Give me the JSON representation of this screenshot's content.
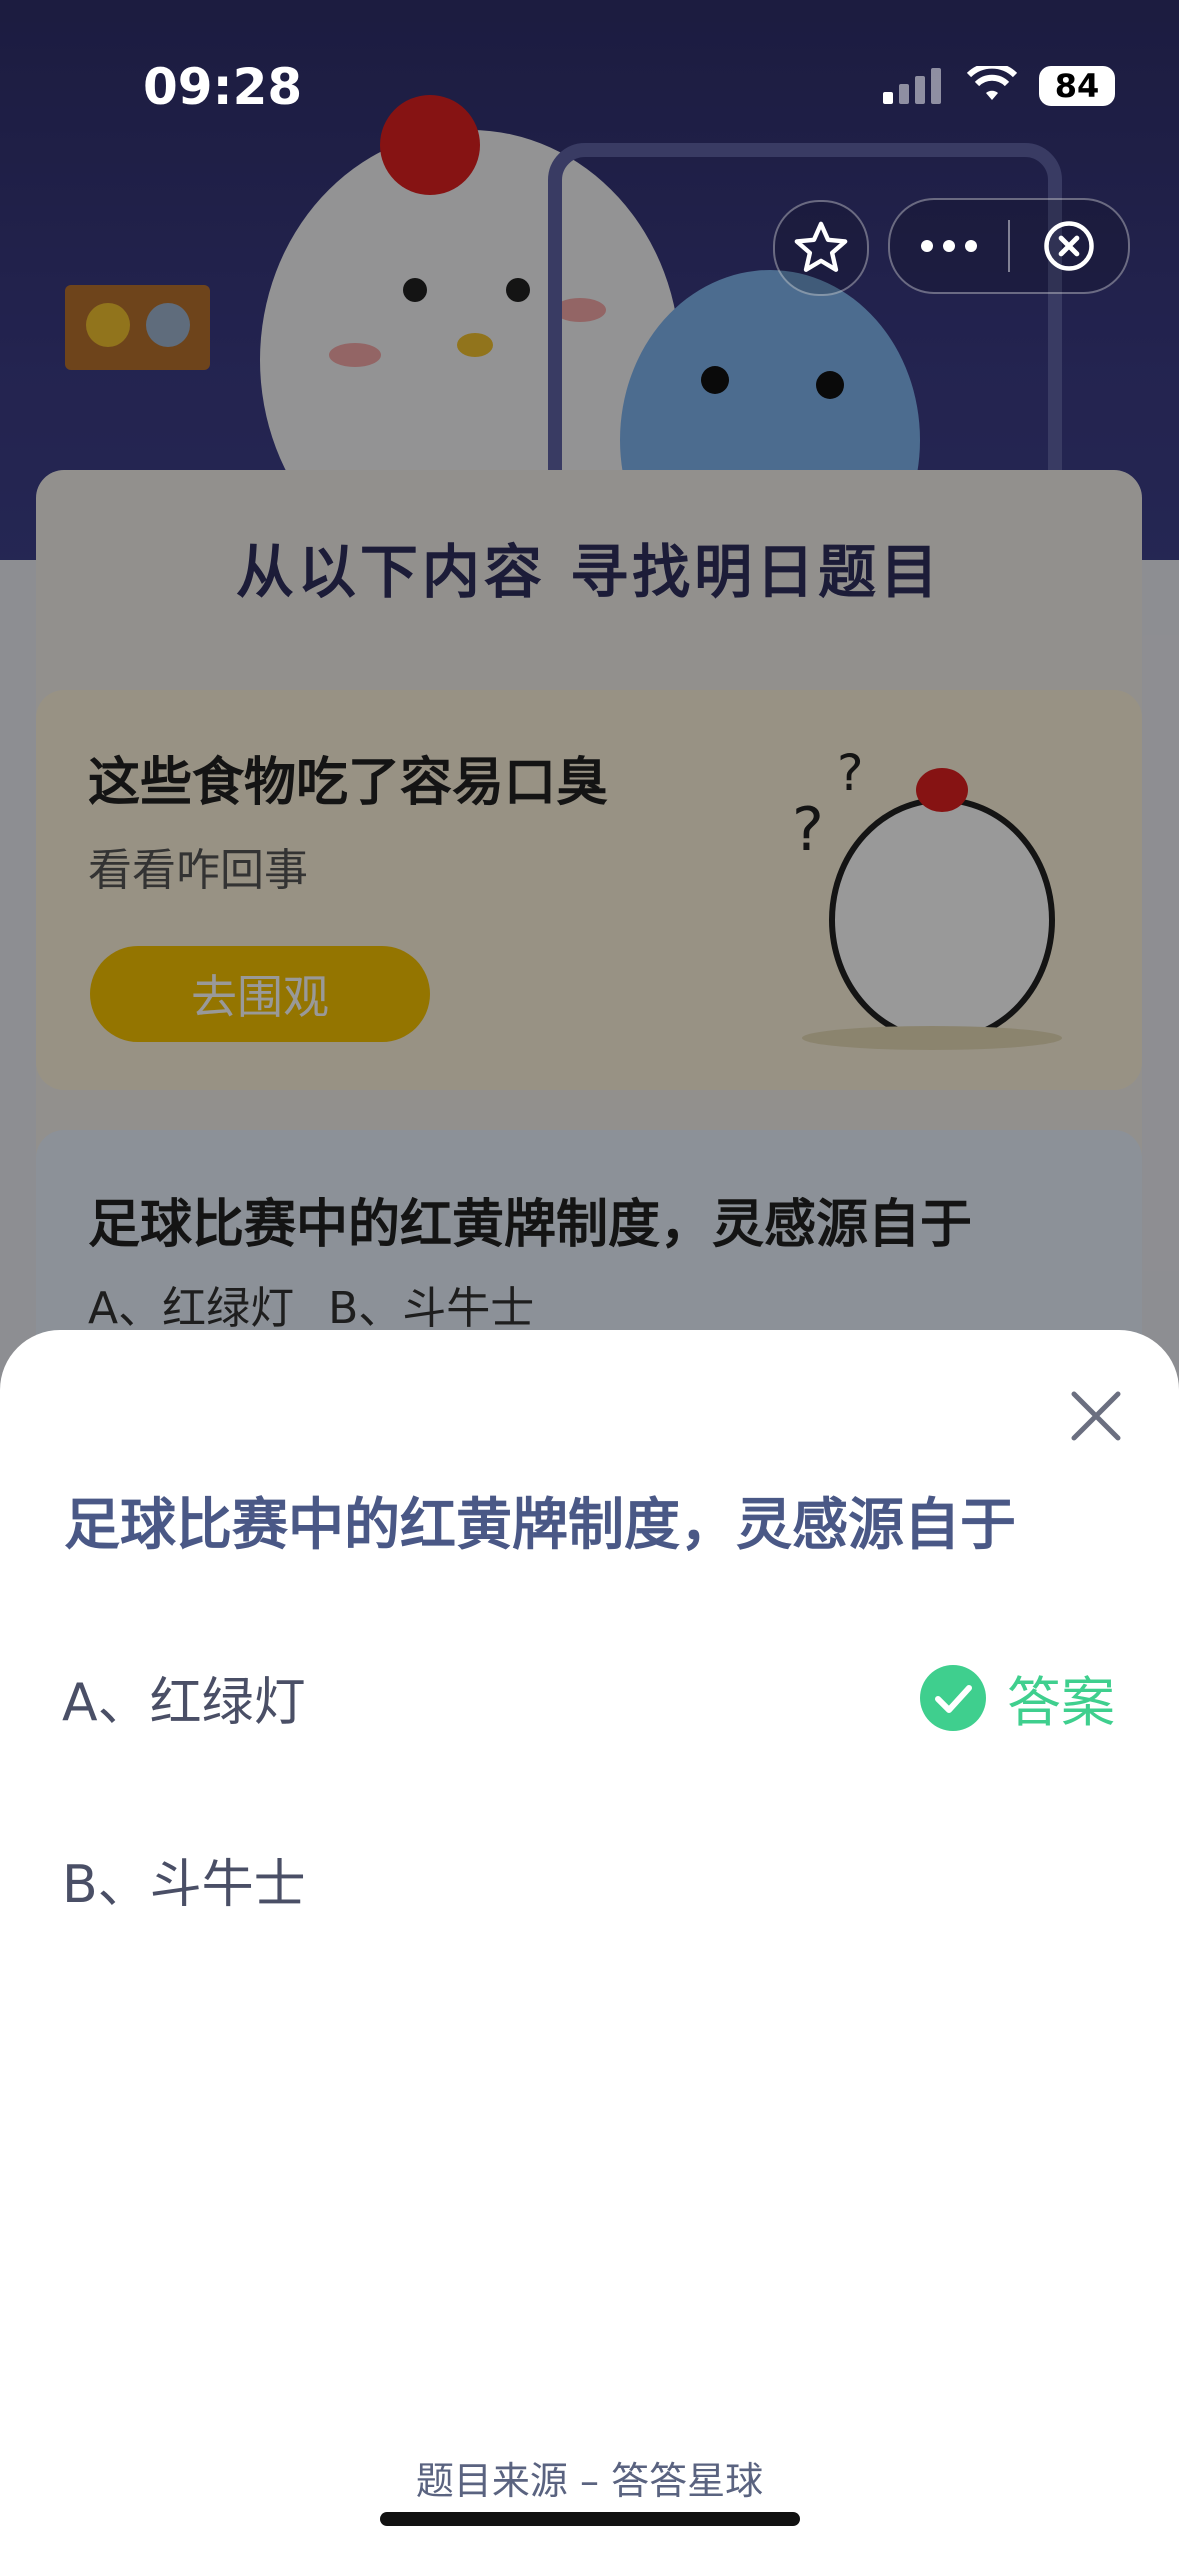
{
  "status_bar": {
    "time": "09:28",
    "battery": "84"
  },
  "mini_program": {
    "section_title": "从以下内容 寻找明日题目",
    "article": {
      "title": "这些食物吃了容易口臭",
      "subtitle": "看看咋回事",
      "button": "去围观"
    },
    "question_card": {
      "title": "足球比赛中的红黄牌制度，灵感源自于",
      "options_line": "A、红绿灯 B、斗牛士"
    }
  },
  "sheet": {
    "question": "足球比赛中的红黄牌制度，灵感源自于",
    "options": [
      {
        "label": "A、红绿灯",
        "is_answer": true
      },
      {
        "label": "B、斗牛士",
        "is_answer": false
      }
    ],
    "answer_label": "答案",
    "answer_color": "#3fcf8e",
    "footer": "题目来源 – 答答星球"
  },
  "icons": [
    "star-icon",
    "more-icon",
    "close-circle-icon",
    "close-icon",
    "check-icon",
    "wifi-icon",
    "signal-icon"
  ]
}
